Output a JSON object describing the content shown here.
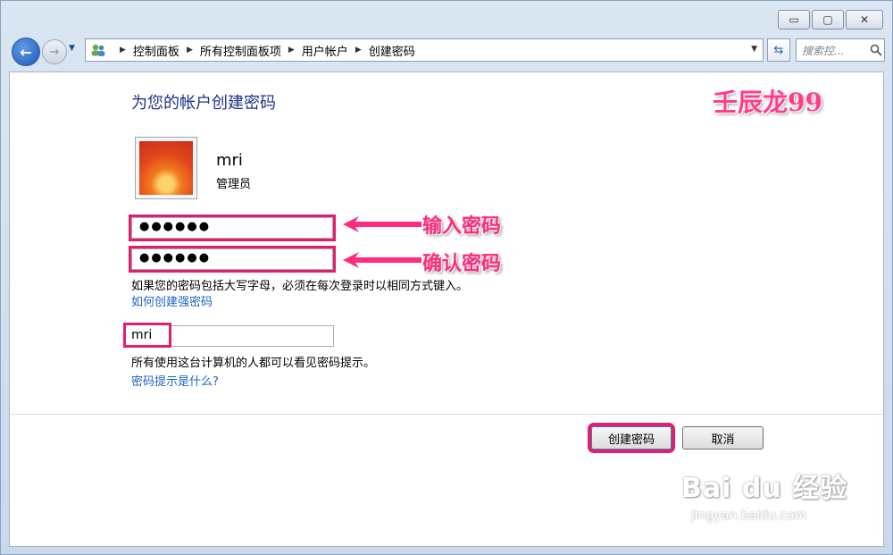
{
  "window": {
    "buttons": {
      "minimize": "▭",
      "maximize": "▢",
      "close": "✕"
    }
  },
  "nav": {
    "breadcrumbs": [
      "控制面板",
      "所有控制面板项",
      "用户帐户",
      "创建密码"
    ],
    "search_placeholder": "搜索控..."
  },
  "page": {
    "title": "为您的帐户创建密码",
    "watermark_top": "壬辰龙99",
    "user": {
      "name": "mri",
      "role": "管理员"
    },
    "password": "●●●●●●",
    "confirm_password": "●●●●●●",
    "annotation_password": "输入密码",
    "annotation_confirm": "确认密码",
    "note": "如果您的密码包括大写字母，必须在每次登录时以相同方式键入。",
    "strong_link": "如何创建强密码",
    "hint_value": "mri",
    "hint_note": "所有使用这台计算机的人都可以看见密码提示。",
    "hint_link": "密码提示是什么?",
    "create_button": "创建密码",
    "cancel_button": "取消"
  },
  "watermark": {
    "logo": "Bai du 经验",
    "url": "jingyan.baidu.com"
  },
  "colors": {
    "accent": "#e0206f",
    "title": "#1e3287",
    "link": "#1a64c0"
  }
}
